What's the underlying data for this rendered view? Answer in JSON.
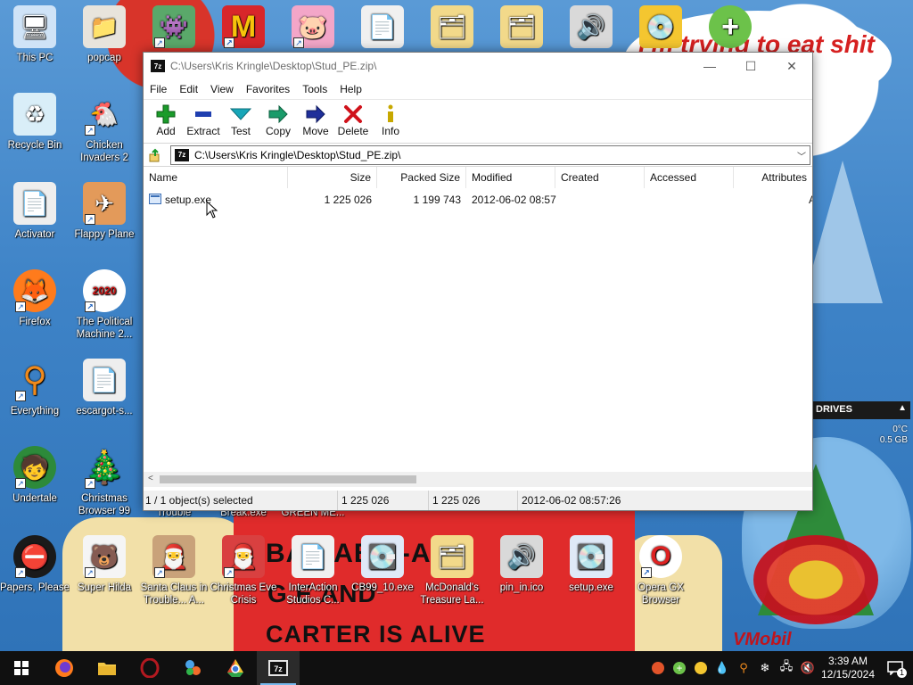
{
  "wallpaper": {
    "bubble_text": "I'm trying to eat shit now",
    "poster_line1": "BA HAB-L-AS",
    "poster_line2": "G E AND",
    "poster_line3": "CARTER IS ALIVE",
    "watermark": "VMobil",
    "drives_title": "DRIVES",
    "drives_temp": "0°C",
    "drives_size": "0.5 GB"
  },
  "desktop_icons": [
    {
      "label": "This PC",
      "icon": "computer-icon"
    },
    {
      "label": "popcap",
      "icon": "folder-icon"
    },
    {
      "label": "",
      "icon": "pixel-character-icon"
    },
    {
      "label": "",
      "icon": "mcdonalds-icon"
    },
    {
      "label": "",
      "icon": "pig-icon"
    },
    {
      "label": "",
      "icon": "document-icon"
    },
    {
      "label": "",
      "icon": "zip-folder-icon"
    },
    {
      "label": "",
      "icon": "zip-folder-icon"
    },
    {
      "label": "",
      "icon": "speaker-icon"
    },
    {
      "label": "",
      "icon": "cd-icon"
    },
    {
      "label": "",
      "icon": "plus-icon"
    },
    {
      "label": "Recycle Bin",
      "icon": "recycle-bin-icon"
    },
    {
      "label": "Chicken Invaders 2",
      "icon": "chicken-icon"
    },
    {
      "label": "Activator",
      "icon": "file-icon"
    },
    {
      "label": "Flappy Plane",
      "icon": "plane-icon"
    },
    {
      "label": "Firefox",
      "icon": "firefox-icon"
    },
    {
      "label": "The Political Machine 2...",
      "icon": "political-icon"
    },
    {
      "label": "Everything",
      "icon": "search-icon"
    },
    {
      "label": "escargot-s...",
      "icon": "file-icon"
    },
    {
      "label": "Undertale",
      "icon": "undertale-icon"
    },
    {
      "label": "Christmas Browser 99",
      "icon": "tree-icon"
    },
    {
      "label": "Papers, Please",
      "icon": "papers-icon"
    },
    {
      "label": "Super Hilda",
      "icon": "pixel-icon"
    },
    {
      "label": "Santa Claus in Trouble... A...",
      "icon": "santa-icon"
    },
    {
      "label": "Christmas Eve Crisis",
      "icon": "santa-icon"
    },
    {
      "label": "InterAction Studios C...",
      "icon": "document-icon"
    },
    {
      "label": "CB99_10.exe",
      "icon": "installer-icon"
    },
    {
      "label": "McDonald's Treasure La...",
      "icon": "zip-folder-icon"
    },
    {
      "label": "pin_in.ico",
      "icon": "speaker-icon"
    },
    {
      "label": "setup.exe",
      "icon": "installer-icon"
    },
    {
      "label": "Opera GX Browser",
      "icon": "opera-icon"
    },
    {
      "label": "Trouble",
      "icon": ""
    },
    {
      "label": "Break.exe",
      "icon": ""
    },
    {
      "label": "GREEN ME...",
      "icon": ""
    }
  ],
  "window": {
    "title": "C:\\Users\\Kris Kringle\\Desktop\\Stud_PE.zip\\",
    "app_icon_text": "7z",
    "controls": {
      "minimize": "—",
      "maximize": "☐",
      "close": "✕"
    },
    "menu": [
      "File",
      "Edit",
      "View",
      "Favorites",
      "Tools",
      "Help"
    ],
    "toolbar": [
      {
        "label": "Add",
        "icon": "add-icon",
        "color": "#1a9b2a"
      },
      {
        "label": "Extract",
        "icon": "extract-icon",
        "color": "#1f3fb0"
      },
      {
        "label": "Test",
        "icon": "test-icon",
        "color": "#18a6b8"
      },
      {
        "label": "Copy",
        "icon": "copy-icon",
        "color": "#1a9b6a"
      },
      {
        "label": "Move",
        "icon": "move-icon",
        "color": "#1f2f9a"
      },
      {
        "label": "Delete",
        "icon": "delete-icon",
        "color": "#d0121b"
      },
      {
        "label": "Info",
        "icon": "info-icon",
        "color": "#c7a800"
      }
    ],
    "address": "C:\\Users\\Kris Kringle\\Desktop\\Stud_PE.zip\\",
    "columns": [
      "Name",
      "Size",
      "Packed Size",
      "Modified",
      "Created",
      "Accessed",
      "Attributes"
    ],
    "rows": [
      {
        "name": "setup.exe",
        "size": "1 225 026",
        "packed_size": "1 199 743",
        "modified": "2012-06-02 08:57",
        "created": "",
        "accessed": "",
        "attributes": "A"
      }
    ],
    "status": {
      "selection": "1 / 1 object(s) selected",
      "size": "1 225 026",
      "packed": "1 225 026",
      "modified": "2012-06-02 08:57:26"
    }
  },
  "taskbar": {
    "apps": [
      {
        "name": "start",
        "icon": "windows-icon"
      },
      {
        "name": "firefox",
        "icon": "firefox-icon"
      },
      {
        "name": "file-explorer",
        "icon": "folder-icon"
      },
      {
        "name": "opera",
        "icon": "opera-icon"
      },
      {
        "name": "app",
        "icon": "app-icon"
      },
      {
        "name": "chrome",
        "icon": "chrome-icon"
      },
      {
        "name": "7zip",
        "icon": "7zip-icon",
        "active": true
      }
    ],
    "clock_time": "3:39 AM",
    "clock_date": "12/15/2024",
    "notification_count": "1"
  }
}
